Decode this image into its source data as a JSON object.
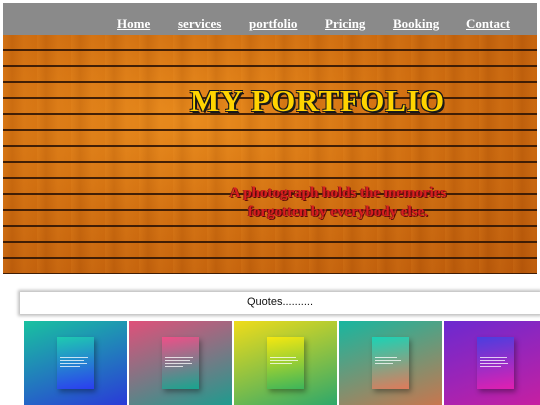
{
  "nav": {
    "items": [
      {
        "label": "Home"
      },
      {
        "label": "services"
      },
      {
        "label": "portfolio"
      },
      {
        "label": "Pricing"
      },
      {
        "label": "Booking"
      },
      {
        "label": "Contact"
      }
    ]
  },
  "hero": {
    "title": "MY PORTFOLIO",
    "quote_line1": "A photograph holds the memories",
    "quote_line2": "forgotten by everybody else."
  },
  "quotes": {
    "label": "Quotes.........."
  },
  "gallery": {
    "tiles": [
      {
        "name": "blue-gradient-poster-tile",
        "colors": [
          "#19c2a0",
          "#2a3ad8"
        ],
        "poster_colors": [
          "#1ecbb0",
          "#2b3df0"
        ]
      },
      {
        "name": "pink-teal-gradient-poster-tile",
        "colors": [
          "#e0507a",
          "#1f9b8e"
        ],
        "poster_colors": [
          "#ef4f88",
          "#17a58f"
        ]
      },
      {
        "name": "yellow-green-gradient-poster-tile",
        "colors": [
          "#f0dc1a",
          "#2ea86a"
        ],
        "poster_colors": [
          "#f6e80f",
          "#3cb55a"
        ]
      },
      {
        "name": "teal-orange-gradient-poster-tile",
        "colors": [
          "#17b7a0",
          "#c8764e"
        ],
        "poster_colors": [
          "#1ad3b6",
          "#e07a5a"
        ]
      },
      {
        "name": "purple-magenta-gradient-poster-tile",
        "colors": [
          "#6b2ad0",
          "#c81fa0"
        ],
        "poster_colors": [
          "#4a3ee0",
          "#e21fb0"
        ]
      }
    ]
  },
  "colors": {
    "nav_bg": "#8a8a8a",
    "title": "#ffd400",
    "quote": "#d81e1e",
    "wood": "#d2700e"
  }
}
